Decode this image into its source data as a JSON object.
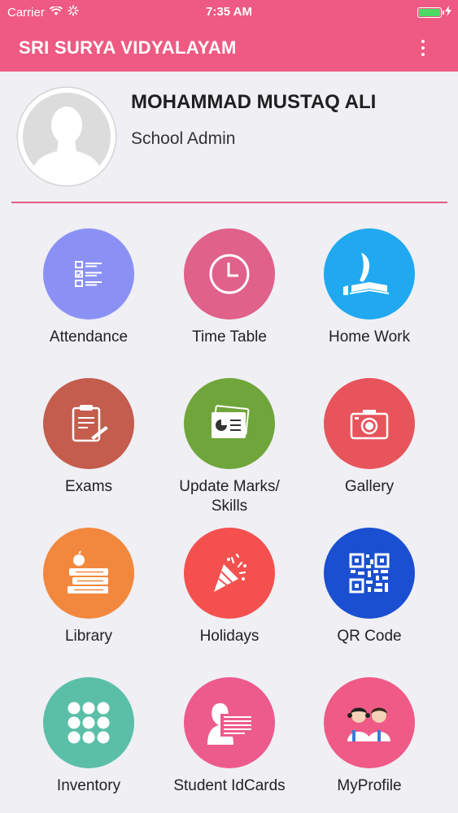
{
  "status_bar": {
    "carrier": "Carrier",
    "time": "7:35 AM"
  },
  "app_bar": {
    "title": "SRI SURYA VIDYALAYAM"
  },
  "profile": {
    "name": "MOHAMMAD MUSTAQ ALI",
    "role": "School Admin"
  },
  "colors": {
    "primary": "#ee5a82",
    "background": "#efeff4"
  },
  "menu": [
    {
      "label": "Attendance",
      "color": "#8b91f4",
      "icon": "checklist-icon"
    },
    {
      "label": "Time Table",
      "color": "#e0618a",
      "icon": "clock-icon"
    },
    {
      "label": "Home Work",
      "color": "#20a9f1",
      "icon": "book-quill-icon"
    },
    {
      "label": "Exams",
      "color": "#c45d4d",
      "icon": "clipboard-icon"
    },
    {
      "label": "Update Marks/ Skills",
      "color": "#6fa53b",
      "icon": "report-card-icon"
    },
    {
      "label": "Gallery",
      "color": "#e8545b",
      "icon": "camera-icon"
    },
    {
      "label": "Library",
      "color": "#f2883e",
      "icon": "books-apple-icon"
    },
    {
      "label": "Holidays",
      "color": "#f4504e",
      "icon": "party-popper-icon"
    },
    {
      "label": "QR Code",
      "color": "#1b4fd1",
      "icon": "qr-code-icon"
    },
    {
      "label": "Inventory",
      "color": "#5bbfa7",
      "icon": "dots-grid-icon"
    },
    {
      "label": "Student IdCards",
      "color": "#ed5a8c",
      "icon": "id-card-icon"
    },
    {
      "label": "MyProfile",
      "color": "#ef5a86",
      "icon": "students-icon"
    }
  ]
}
